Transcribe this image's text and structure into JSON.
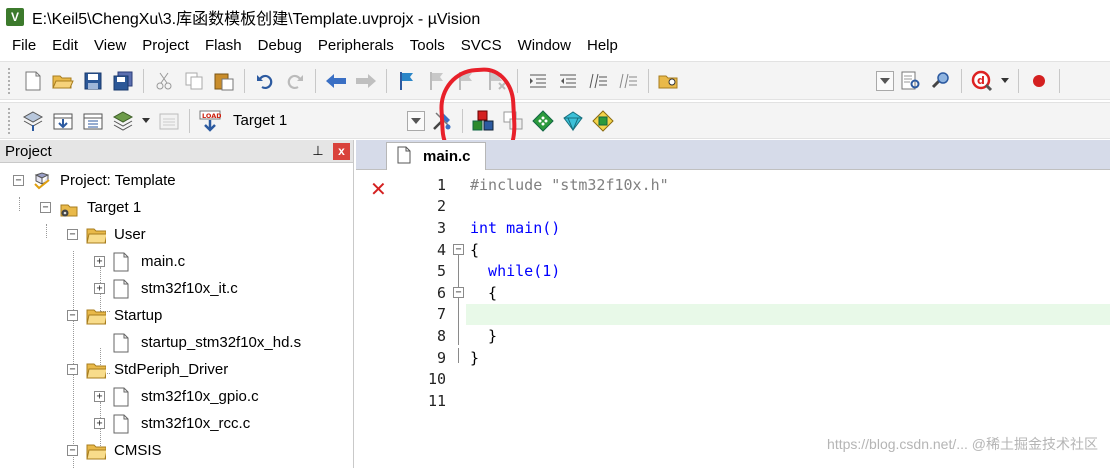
{
  "window": {
    "title": "E:\\Keil5\\ChengXu\\3.库函数模板创建\\Template.uvprojx - µVision",
    "app_icon": "V"
  },
  "menu": [
    "File",
    "Edit",
    "View",
    "Project",
    "Flash",
    "Debug",
    "Peripherals",
    "Tools",
    "SVCS",
    "Window",
    "Help"
  ],
  "toolbar2": {
    "target": "Target 1",
    "load_label": "LOAD"
  },
  "project_panel": {
    "title": "Project",
    "pin_icon": "pin-icon",
    "close_label": "x",
    "tree": [
      {
        "label": "Project: Template",
        "icon": "project-icon"
      },
      {
        "label": "Target 1",
        "icon": "target-icon"
      },
      {
        "label": "User",
        "icon": "folder-icon"
      },
      {
        "label": "main.c",
        "icon": "file-icon"
      },
      {
        "label": "stm32f10x_it.c",
        "icon": "file-icon"
      },
      {
        "label": "Startup",
        "icon": "folder-icon"
      },
      {
        "label": "startup_stm32f10x_hd.s",
        "icon": "file-icon"
      },
      {
        "label": "StdPeriph_Driver",
        "icon": "folder-icon"
      },
      {
        "label": "stm32f10x_gpio.c",
        "icon": "file-icon"
      },
      {
        "label": "stm32f10x_rcc.c",
        "icon": "file-icon"
      },
      {
        "label": "CMSIS",
        "icon": "folder-icon"
      }
    ]
  },
  "editor": {
    "tab_label": "main.c",
    "lines": [
      {
        "num": "1",
        "text": "#include \"stm32f10x.h\""
      },
      {
        "num": "2",
        "text": ""
      },
      {
        "num": "3",
        "text": "int main()"
      },
      {
        "num": "4",
        "text": "{"
      },
      {
        "num": "5",
        "text": "  while(1)"
      },
      {
        "num": "6",
        "text": "  {"
      },
      {
        "num": "7",
        "text": ""
      },
      {
        "num": "8",
        "text": "  }"
      },
      {
        "num": "9",
        "text": "}"
      },
      {
        "num": "10",
        "text": ""
      },
      {
        "num": "11",
        "text": ""
      }
    ],
    "error_marker": "✕"
  },
  "watermark": "https://blog.csdn.net/... @稀土掘金技术社区",
  "colors": {
    "annotation": "#e8202a",
    "highlight_line": "#e8f9e8",
    "keyword": "#0000ff"
  }
}
